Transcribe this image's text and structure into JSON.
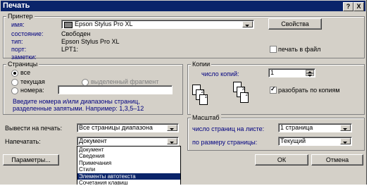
{
  "title": "Печать",
  "title_buttons": {
    "help": "?",
    "close": "X"
  },
  "printer": {
    "group_label": "Принтер",
    "name_label": "имя:",
    "name_value": "Epson Stylus Pro XL",
    "properties_button": "Свойства",
    "status_label": "состояние:",
    "status_value": "Свободен",
    "type_label": "тип:",
    "type_value": "Epson Stylus Pro XL",
    "port_label": "порт:",
    "port_value": "LPT1:",
    "notes_label": "заметки:",
    "print_to_file": "печать в файл"
  },
  "pages": {
    "group_label": "Страницы",
    "all": "все",
    "current": "текущая",
    "selection": "выделенный фрагмент",
    "numbers": "номера:",
    "hint_line1": "Введите номера и/или диапазоны страниц,",
    "hint_line2": "разделенные запятыми. Например: 1,3,5–12"
  },
  "copies": {
    "group_label": "Копии",
    "count_label": "число копий:",
    "count_value": "1",
    "collate": "разобрать по копиям"
  },
  "print_what": {
    "label": "Вывести на печать:",
    "value": "Все страницы диапазона"
  },
  "print_type": {
    "label": "Напечатать:",
    "value": "Документ",
    "options": [
      "Документ",
      "Сведения",
      "Примечания",
      "Стили",
      "Элементы автотекста",
      "Сочетания клавиш"
    ],
    "selected_index": 4
  },
  "zoom": {
    "group_label": "Масштаб",
    "pages_per_sheet_label": "число страниц на листе:",
    "pages_per_sheet_value": "1 страница",
    "scale_label": "по размеру страницы:",
    "scale_value": "Текущий"
  },
  "buttons": {
    "options": "Параметры...",
    "ok": "ОК",
    "cancel": "Отмена"
  }
}
